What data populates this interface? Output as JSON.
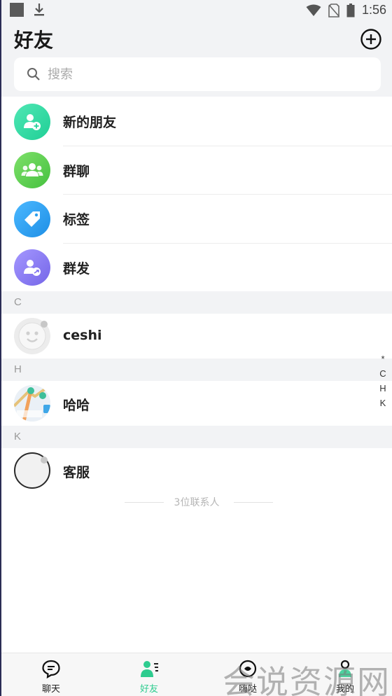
{
  "status_bar": {
    "time": "1:56"
  },
  "header": {
    "title": "好友"
  },
  "search": {
    "placeholder": "搜索"
  },
  "menu": [
    {
      "label": "新的朋友",
      "icon": "add-user-icon",
      "color": "#2fdca0"
    },
    {
      "label": "群聊",
      "icon": "group-icon",
      "color": "#5fd35a"
    },
    {
      "label": "标签",
      "icon": "tag-icon",
      "color": "#2b9ff0"
    },
    {
      "label": "群发",
      "icon": "broadcast-icon",
      "color": "#8a7cf0"
    }
  ],
  "sections": [
    {
      "letter": "C",
      "contacts": [
        {
          "name": "ceshi"
        }
      ]
    },
    {
      "letter": "H",
      "contacts": [
        {
          "name": "哈哈"
        }
      ]
    },
    {
      "letter": "K",
      "contacts": [
        {
          "name": "客服"
        }
      ]
    }
  ],
  "index_letters": [
    "*",
    "C",
    "H",
    "K"
  ],
  "contact_count": "3位联系人",
  "tabs": [
    {
      "label": "聊天",
      "icon": "chat-bubble-icon",
      "active": false
    },
    {
      "label": "好友",
      "icon": "contacts-icon",
      "active": true
    },
    {
      "label": "嗨哒",
      "icon": "discover-icon",
      "active": false
    },
    {
      "label": "我的",
      "icon": "profile-icon",
      "active": false
    }
  ],
  "watermark": "会说资源网",
  "colors": {
    "accent": "#2ecc8f",
    "background": "#f2f3f5"
  }
}
